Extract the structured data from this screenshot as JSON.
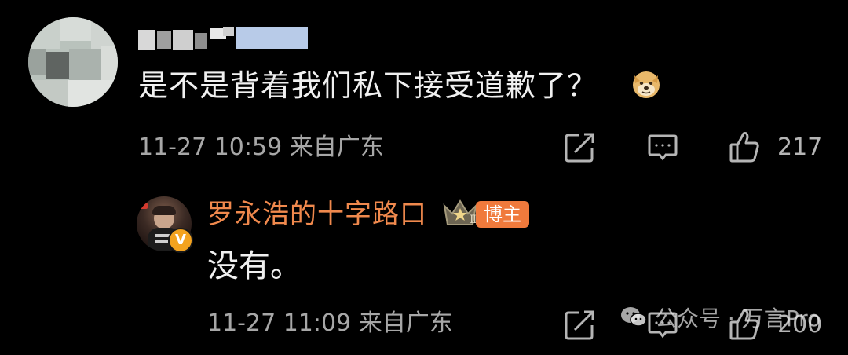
{
  "comments": [
    {
      "text": "是不是背着我们私下接受道歉了？",
      "emoji": "doge-emoji",
      "meta": "11-27 10:59 来自广东",
      "likes": "217",
      "icons": {
        "share": "share-icon",
        "comment": "comment-icon",
        "like": "thumbs-up-icon"
      }
    }
  ],
  "reply": {
    "author": "罗永浩的十字路口",
    "badge": "博主",
    "crown_level": "Ⅱ",
    "verified_mark": "V",
    "text": "没有。",
    "meta": "11-27 11:09 来自广东",
    "likes": "200"
  },
  "watermark": {
    "text": "公众号 · 万言Pro"
  },
  "colors": {
    "background": "#000000",
    "author_accent": "#f0894d",
    "badge_bg": "#f07a3c",
    "verified": "#f4a31f",
    "meta_text": "#a7a7a7"
  }
}
